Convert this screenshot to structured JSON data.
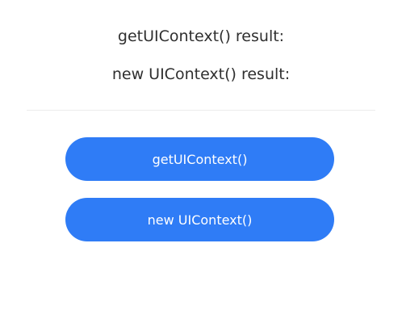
{
  "results": {
    "get_label": "getUIContext() result:",
    "new_label": "new UIContext() result:"
  },
  "buttons": {
    "get": "getUIContext()",
    "new": "new UIContext()"
  },
  "colors": {
    "accent": "#2f7cf6",
    "text": "#2f2f2f",
    "divider": "#ececec",
    "background": "#ffffff"
  }
}
